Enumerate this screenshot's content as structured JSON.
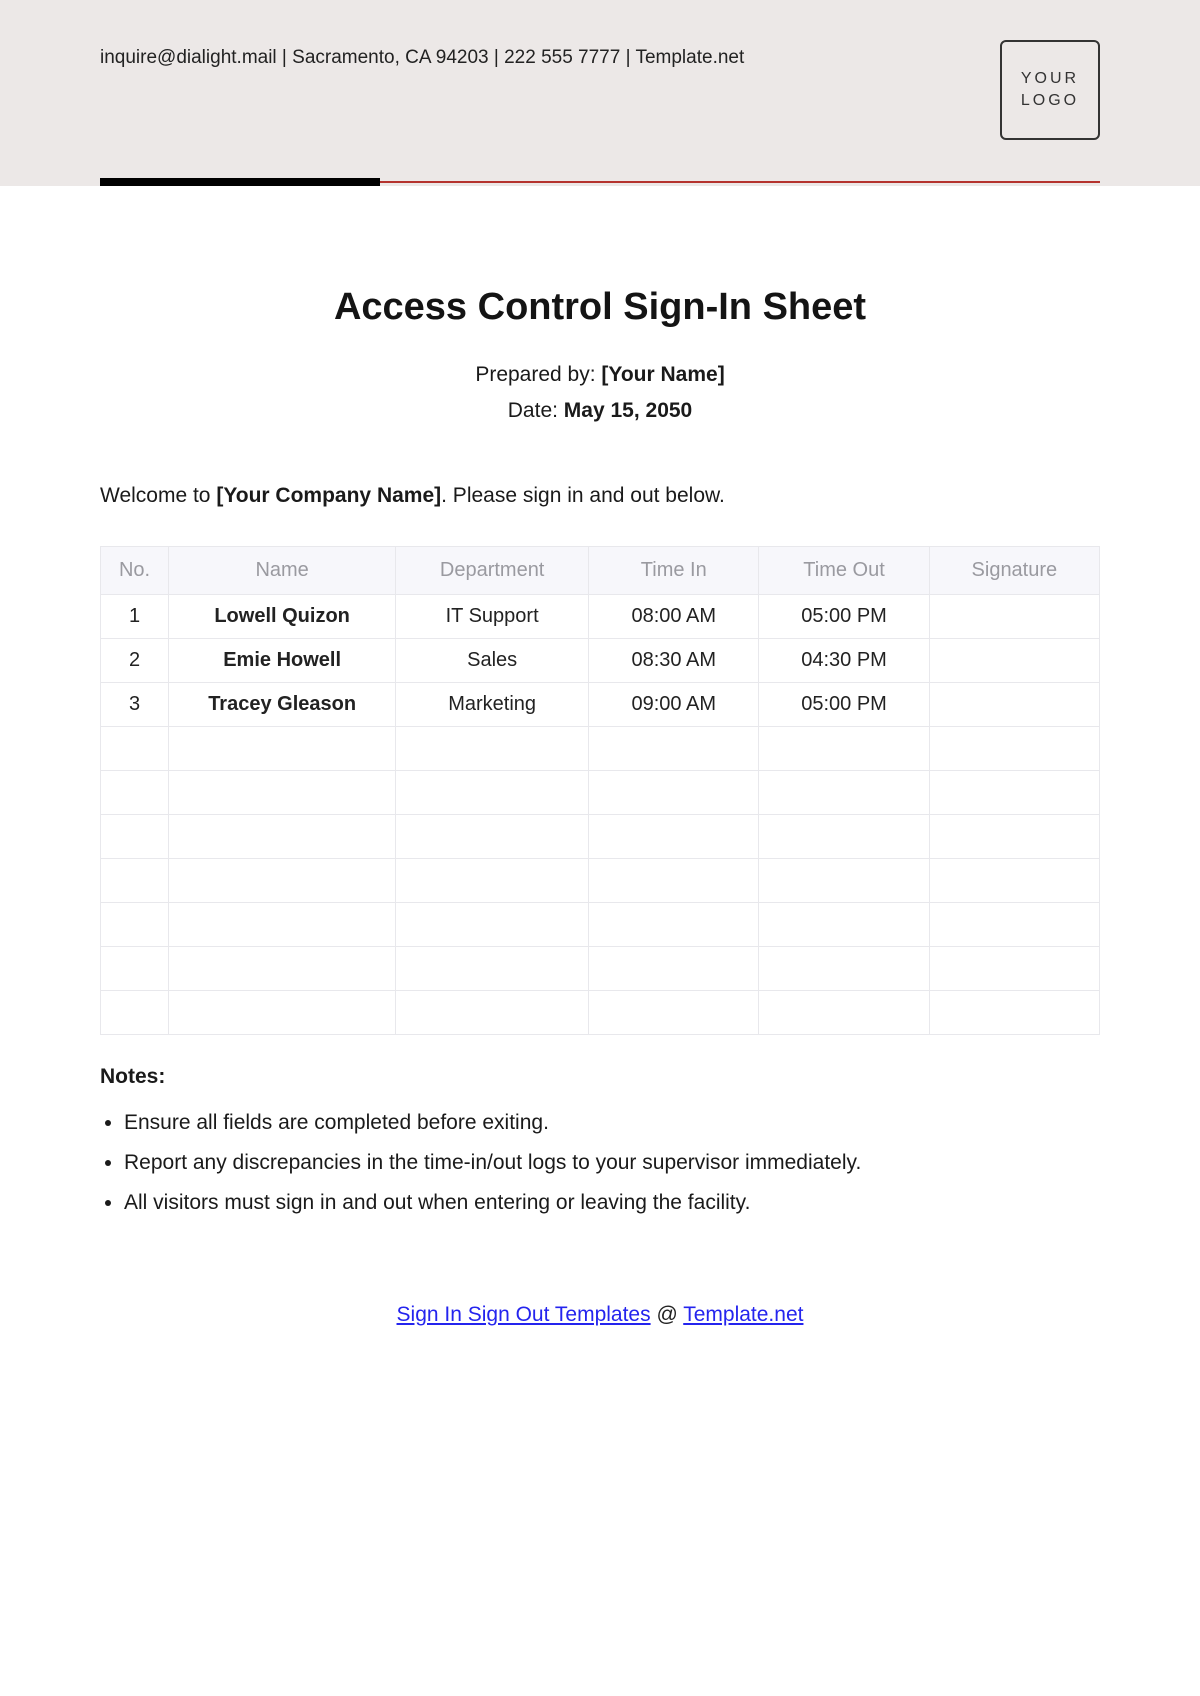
{
  "header": {
    "contact": "inquire@dialight.mail | Sacramento, CA 94203 | 222 555 7777 | Template.net",
    "logo_line1": "YOUR",
    "logo_line2": "LOGO"
  },
  "title": "Access Control Sign-In Sheet",
  "meta": {
    "prepared_by_label": "Prepared by: ",
    "prepared_by_value": "[Your Name]",
    "date_label": "Date: ",
    "date_value": "May 15, 2050"
  },
  "welcome": {
    "pre": "Welcome to ",
    "company": "[Your Company Name]",
    "post": ". Please sign in and out below."
  },
  "table": {
    "headers": {
      "no": "No.",
      "name": "Name",
      "dept": "Department",
      "time_in": "Time In",
      "time_out": "Time Out",
      "signature": "Signature"
    },
    "rows": [
      {
        "no": "1",
        "name": "Lowell Quizon",
        "dept": "IT Support",
        "tin": "08:00 AM",
        "tout": "05:00 PM",
        "sig": ""
      },
      {
        "no": "2",
        "name": "Emie Howell",
        "dept": "Sales",
        "tin": "08:30 AM",
        "tout": "04:30 PM",
        "sig": ""
      },
      {
        "no": "3",
        "name": "Tracey Gleason",
        "dept": "Marketing",
        "tin": "09:00 AM",
        "tout": "05:00 PM",
        "sig": ""
      },
      {
        "no": "",
        "name": "",
        "dept": "",
        "tin": "",
        "tout": "",
        "sig": ""
      },
      {
        "no": "",
        "name": "",
        "dept": "",
        "tin": "",
        "tout": "",
        "sig": ""
      },
      {
        "no": "",
        "name": "",
        "dept": "",
        "tin": "",
        "tout": "",
        "sig": ""
      },
      {
        "no": "",
        "name": "",
        "dept": "",
        "tin": "",
        "tout": "",
        "sig": ""
      },
      {
        "no": "",
        "name": "",
        "dept": "",
        "tin": "",
        "tout": "",
        "sig": ""
      },
      {
        "no": "",
        "name": "",
        "dept": "",
        "tin": "",
        "tout": "",
        "sig": ""
      },
      {
        "no": "",
        "name": "",
        "dept": "",
        "tin": "",
        "tout": "",
        "sig": ""
      }
    ]
  },
  "notes_title": "Notes:",
  "notes": [
    "Ensure all fields are completed before exiting.",
    "Report any discrepancies in the time-in/out logs to your supervisor immediately.",
    "All visitors must sign in and out when entering or leaving the facility."
  ],
  "footer": {
    "link1": "Sign In Sign Out Templates",
    "at": " @ ",
    "link2": "Template.net"
  }
}
